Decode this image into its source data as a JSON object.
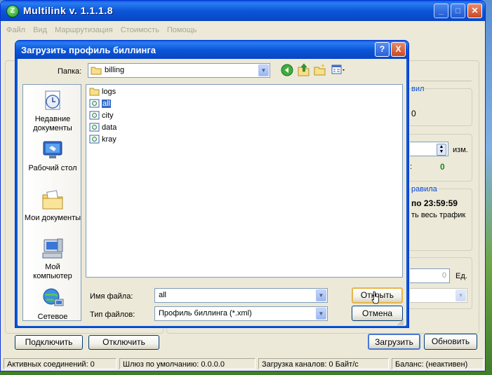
{
  "main": {
    "title": "Multilink v. 1.1.1.8",
    "app_icon_letter": "Z",
    "menu": [
      "Файл",
      "Вид",
      "Маршрутизация",
      "Стоимость",
      "Помощь"
    ],
    "right_panel": {
      "fragment_vil": "вил",
      "fragment_zero_a": "0",
      "unit_izm": "изм.",
      "fragment_colon": ":",
      "fragment_zero_b": "0",
      "fragment_pravila": "равила",
      "time_text": "по 23:59:59",
      "traffic_text": "ть весь трафик",
      "spin_value": "0",
      "unit_ed": "Ед."
    },
    "buttons": {
      "connect": "Подключить",
      "disconnect": "Отключить",
      "load": "Загрузить",
      "refresh": "Обновить"
    },
    "status": {
      "active": "Активных соединений: 0",
      "gateway": "Шлюз по умолчанию: 0.0.0.0",
      "channels": "Загрузка каналов: 0 Байт/с",
      "balance": "Баланс: (неактивен)"
    },
    "colors": {
      "title_blue": "#0a56d8",
      "value_green": "#1a8a1a",
      "link_blue": "#0046d5"
    }
  },
  "dialog": {
    "title": "Загрузить профиль биллинга",
    "folder_label": "Папка:",
    "folder_value": "billing",
    "places": [
      {
        "label": "Недавние документы",
        "icon": "recent-documents-icon"
      },
      {
        "label": "Рабочий стол",
        "icon": "desktop-icon"
      },
      {
        "label": "Мои документы",
        "icon": "my-documents-icon"
      },
      {
        "label": "Мой компьютер",
        "icon": "my-computer-icon"
      },
      {
        "label": "Сетевое",
        "icon": "network-icon"
      }
    ],
    "files": [
      {
        "name": "logs",
        "kind": "folder"
      },
      {
        "name": "all",
        "kind": "xml",
        "selected": true
      },
      {
        "name": "city",
        "kind": "xml"
      },
      {
        "name": "data",
        "kind": "xml"
      },
      {
        "name": "kray",
        "kind": "xml"
      }
    ],
    "filename_label": "Имя файла:",
    "filename_value": "all",
    "filetype_label": "Тип файлов:",
    "filetype_value": "Профиль биллинга (*.xml)",
    "open_button": "Открыть",
    "cancel_button": "Отмена",
    "help_button": "?",
    "close_button": "X"
  }
}
